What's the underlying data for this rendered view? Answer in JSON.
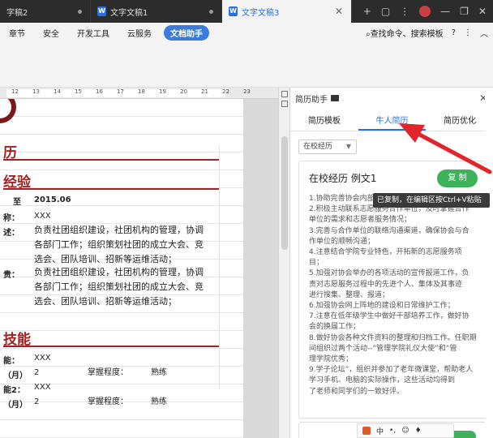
{
  "window": {
    "tabs": [
      {
        "title": "字稿2",
        "active": false
      },
      {
        "title": "文字文稿1",
        "active": false
      },
      {
        "title": "文字文稿3",
        "active": true
      }
    ],
    "controls": [
      "+",
      "▢",
      "⋮",
      "—",
      "❐",
      "✕"
    ]
  },
  "menubar": {
    "items": [
      "章节",
      "安全",
      "开发工具",
      "云服务"
    ],
    "active": "文档助手",
    "search": "查找命令、搜索模板",
    "help": "?",
    "more": "⋮",
    "collapse": "︿"
  },
  "ruler": {
    "ticks": [
      "12",
      "13",
      "14",
      "15",
      "16",
      "17",
      "18",
      "19",
      "20",
      "21",
      "22",
      "23"
    ]
  },
  "document": {
    "sections": [
      {
        "heading": "历"
      },
      {
        "heading": "经验"
      },
      {
        "heading": "技能"
      }
    ],
    "experience": {
      "to_label": "至",
      "to_date": "2015.06",
      "name_label": "称：",
      "name_value": "XXX",
      "desc_label": "述：",
      "desc_lines": [
        "负责社团组织建设，社团机构的管理，协调",
        "各部门工作；组织策划社团的成立大会、竞",
        "选会、团队培训、招新等运维活动；"
      ],
      "duty_label": "贵：",
      "duty_lines": [
        "负责社团组织建设，社团机构的管理，协调",
        "各部门工作；组织策划社团的成立大会、竞",
        "选会、团队培训、招新等运维活动；"
      ]
    },
    "skills": {
      "rows": [
        {
          "label": "能：",
          "value": "XXX"
        },
        {
          "label": "（月）",
          "value": "2",
          "degree_label": "掌握程度：",
          "degree": "熟练"
        },
        {
          "label": "能2：",
          "value": "XXX"
        },
        {
          "label": "（月）",
          "value": "2",
          "degree_label": "掌握程度：",
          "degree": "熟练"
        }
      ]
    }
  },
  "panel": {
    "title": "简历助手",
    "tabs": [
      "简历模板",
      "牛人简历",
      "简历优化"
    ],
    "active_tab": "牛人简历",
    "select_value": "在校经历",
    "card": {
      "title": "在校经历 例文1",
      "copy_label": "复 制",
      "lines": [
        "1.协助完善协会内部",
        "2.积极主动联系志愿服务合作单位，及时掌握合作",
        "单位的需求和志愿者服务情况；",
        "3.完善与合作单位的联络沟通渠道，确保协会与合",
        "作单位的顺畅沟通；",
        "4.注意结合学院专业特色，开拓新的志愿服务项",
        "目；",
        "5.加强对协会举办的各项活动的宣传报道工作，负",
        "责对志愿服务过程中的先进个人、集体及其事迹",
        "进行搜集、整理、报道；",
        "6.加强协会网上阵地的建设和日常维护工作；",
        "7.注意在低年级学生中做好干部培养工作，做好协",
        "会的换届工作；",
        "8.做好协会各种文件资料的整理和归档工作。任职期",
        "间组织过两个活动--“管理学院礼仪大使”和“管",
        "理学院优秀；",
        "9.学子论坛”，组织并参加了老年微课堂，帮助老人",
        "学习手机、电脑的实际操作，这些活动均得到",
        "了老师和同学们的一致好评。"
      ]
    },
    "tooltip": "已复制，在编辑区按Ctrl+V粘贴"
  },
  "colors": {
    "accent": "#2b6fdc",
    "copy_green": "#3db25a",
    "heading_red": "#9e2323",
    "arrow_red": "#e0262a"
  }
}
